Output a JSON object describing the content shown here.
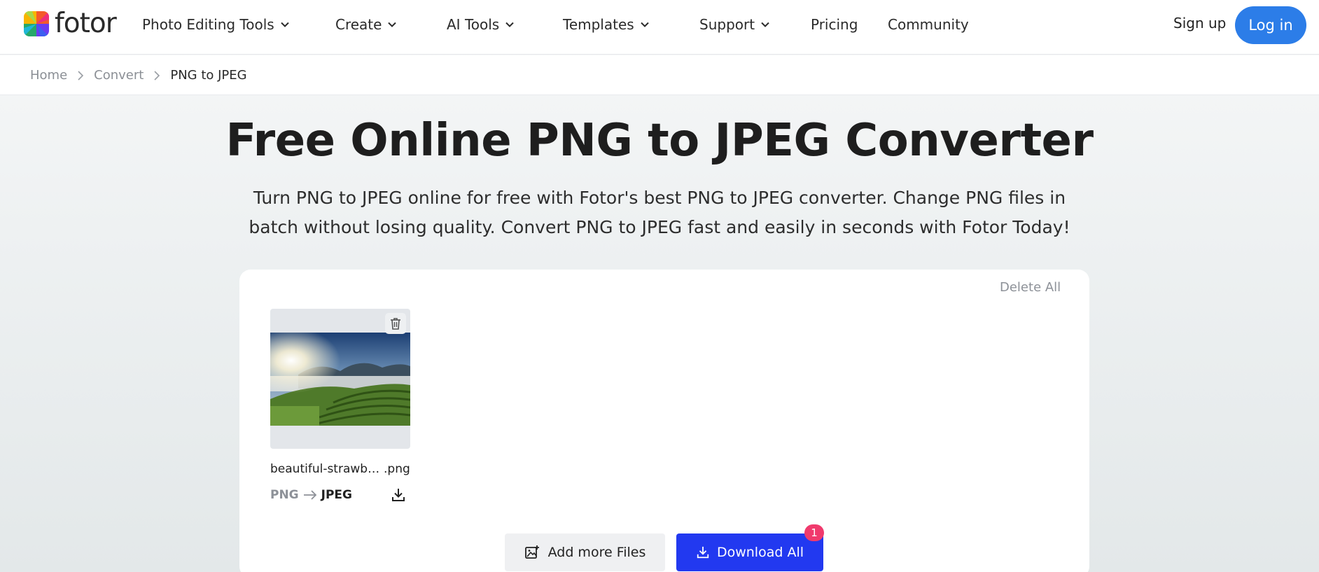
{
  "header": {
    "logo_text": "fotor",
    "nav": [
      {
        "label": "Photo Editing Tools",
        "dropdown": true
      },
      {
        "label": "Create",
        "dropdown": true
      },
      {
        "label": "AI Tools",
        "dropdown": true
      },
      {
        "label": "Templates",
        "dropdown": true
      },
      {
        "label": "Support",
        "dropdown": true
      },
      {
        "label": "Pricing",
        "dropdown": false
      },
      {
        "label": "Community",
        "dropdown": false
      }
    ],
    "signup_label": "Sign up",
    "login_label": "Log in"
  },
  "breadcrumb": {
    "items": [
      "Home",
      "Convert"
    ],
    "current": "PNG to JPEG"
  },
  "hero": {
    "title": "Free Online PNG to JPEG Converter",
    "subtitle_line1": "Turn PNG to JPEG online for free with Fotor's best PNG to JPEG converter. Change PNG files in",
    "subtitle_line2": "batch without losing quality. Convert PNG to JPEG fast and easily in seconds with Fotor Today!"
  },
  "converter": {
    "delete_all_label": "Delete All",
    "files": [
      {
        "name": "beautiful-strawb…",
        "extension": ".png",
        "from_format": "PNG",
        "to_format": "JPEG",
        "thumbnail_icon": "landscape-photo-thumbnail"
      }
    ],
    "add_more_label": "Add more Files",
    "download_all_label": "Download All",
    "download_count": "1"
  },
  "colors": {
    "primary_blue": "#2c7de8",
    "download_blue": "#2239f0",
    "badge_pink": "#f03a6d"
  }
}
